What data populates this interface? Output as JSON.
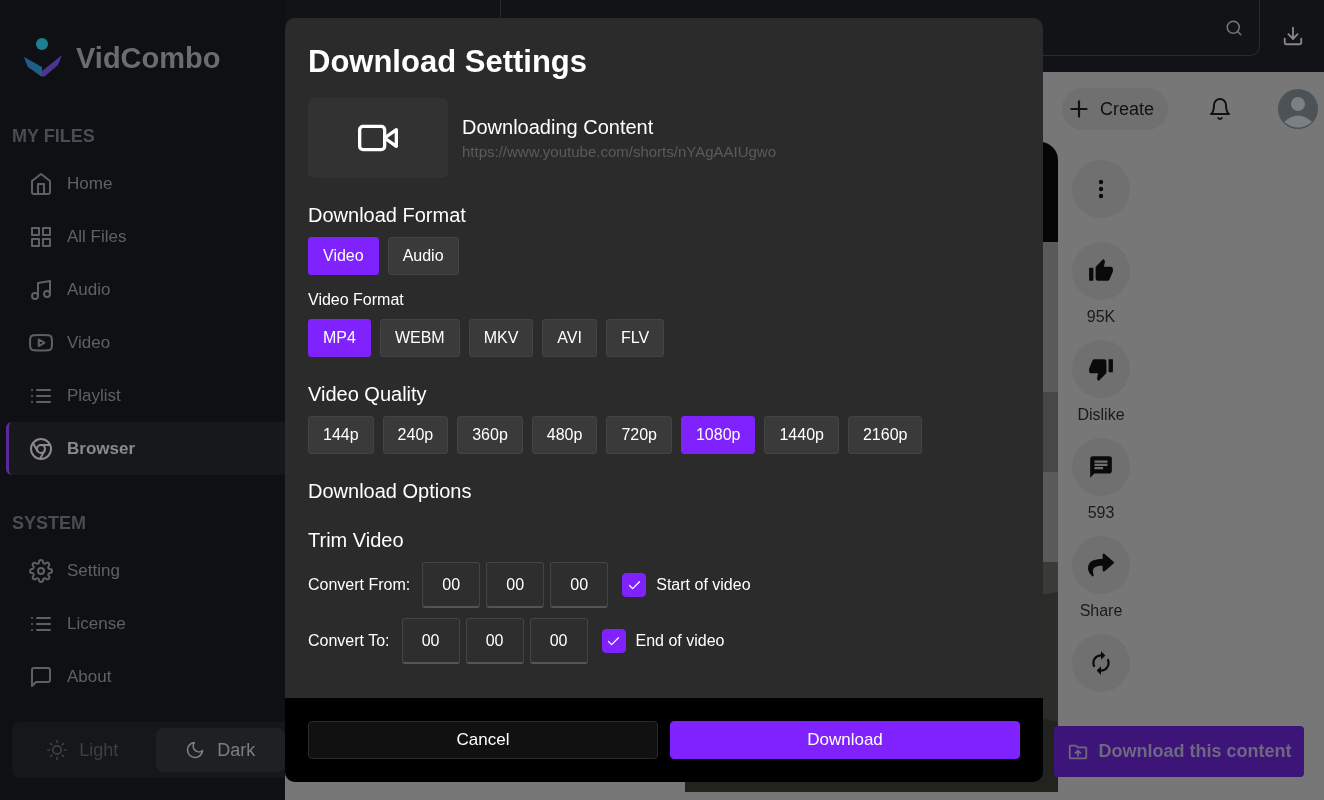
{
  "sidebar": {
    "logo": "VidCombo",
    "sections": [
      {
        "title": "MY FILES",
        "items": [
          {
            "label": "Home",
            "kind": "home",
            "selected": false
          },
          {
            "label": "All Files",
            "kind": "grid",
            "selected": false
          },
          {
            "label": "Audio",
            "kind": "music",
            "selected": false
          },
          {
            "label": "Video",
            "kind": "video",
            "selected": false
          },
          {
            "label": "Playlist",
            "kind": "list",
            "selected": false
          },
          {
            "label": "Browser",
            "kind": "browser",
            "selected": true
          }
        ]
      },
      {
        "title": "SYSTEM",
        "items": [
          {
            "label": "Setting",
            "kind": "settings",
            "selected": false
          },
          {
            "label": "License",
            "kind": "list",
            "selected": false
          },
          {
            "label": "About",
            "kind": "chat",
            "selected": false
          }
        ]
      }
    ],
    "theme_toggle": [
      {
        "label": "Light",
        "kind": "light",
        "selected": false
      },
      {
        "label": "Dark",
        "kind": "dark",
        "selected": true
      }
    ]
  },
  "browser": {
    "create_label": "Create",
    "actions": [
      {
        "kind": "more"
      },
      {
        "kind": "like",
        "label": "95K"
      },
      {
        "kind": "dislike",
        "label": "Dislike"
      },
      {
        "kind": "comment",
        "label": "593"
      },
      {
        "kind": "share",
        "label": "Share"
      },
      {
        "kind": "remix"
      }
    ],
    "download_button": "Download this content"
  },
  "dialog": {
    "title": "Download Settings",
    "content_title": "Downloading Content",
    "url": "https://www.youtube.com/shorts/nYAgAAIUgwo",
    "format_heading": "Download Format",
    "formats": [
      {
        "label": "Video",
        "selected": true
      },
      {
        "label": "Audio",
        "selected": false
      }
    ],
    "video_format_label": "Video Format",
    "video_formats": [
      {
        "label": "MP4",
        "selected": true
      },
      {
        "label": "WEBM",
        "selected": false
      },
      {
        "label": "MKV",
        "selected": false
      },
      {
        "label": "AVI",
        "selected": false
      },
      {
        "label": "FLV",
        "selected": false
      }
    ],
    "quality_heading": "Video Quality",
    "qualities": [
      {
        "label": "144p",
        "selected": false
      },
      {
        "label": "240p",
        "selected": false
      },
      {
        "label": "360p",
        "selected": false
      },
      {
        "label": "480p",
        "selected": false
      },
      {
        "label": "720p",
        "selected": false
      },
      {
        "label": "1080p",
        "selected": true
      },
      {
        "label": "1440p",
        "selected": false
      },
      {
        "label": "2160p",
        "selected": false
      }
    ],
    "options_heading": "Download Options",
    "trim_heading": "Trim Video",
    "trim_rows": [
      {
        "label": "Convert From:",
        "values": [
          "00",
          "00",
          "00"
        ],
        "checkbox_label": "Start of video",
        "checked": true
      },
      {
        "label": "Convert To:",
        "values": [
          "00",
          "00",
          "00"
        ],
        "checkbox_label": "End of video",
        "checked": true
      }
    ],
    "buttons": [
      {
        "label": "Cancel",
        "kind": "secondary"
      },
      {
        "label": "Download",
        "kind": "primary"
      }
    ]
  }
}
